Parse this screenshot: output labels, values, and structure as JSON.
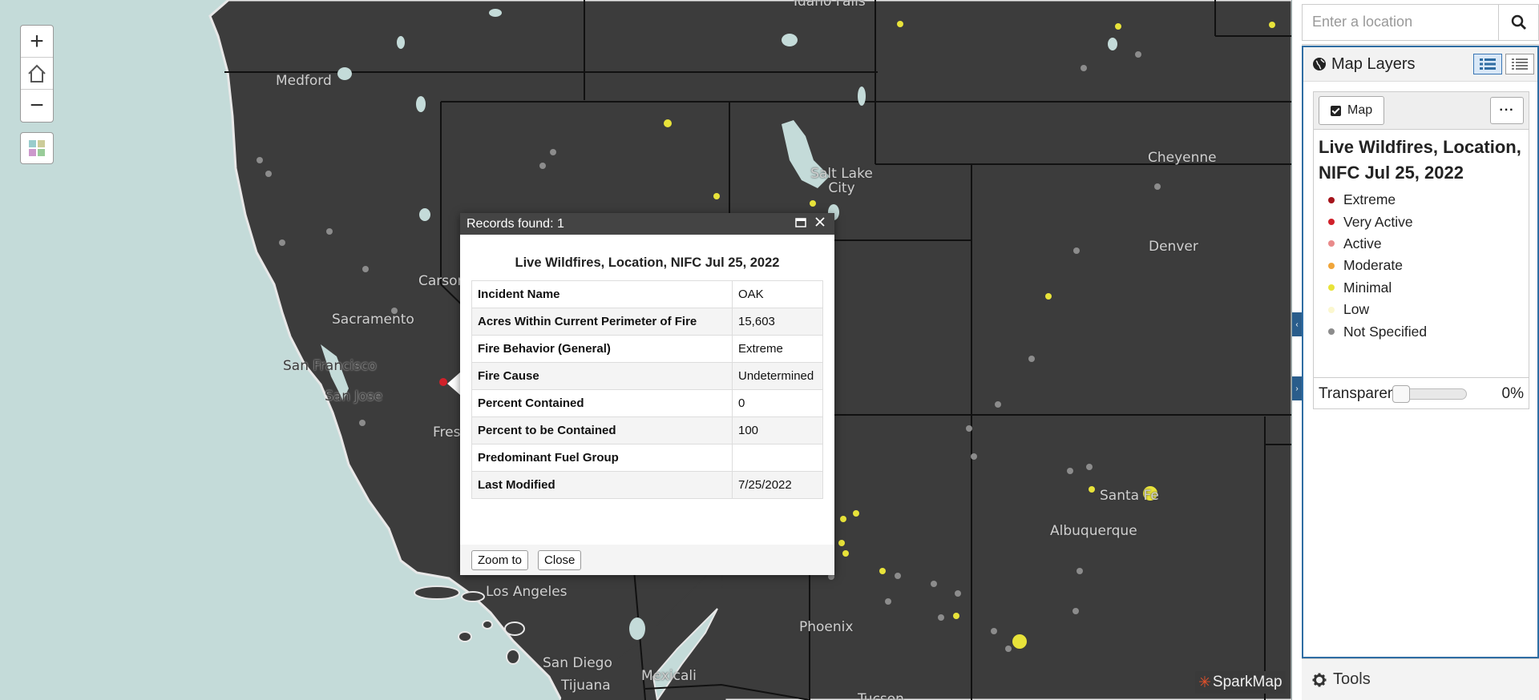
{
  "map": {
    "cities": [
      {
        "name": "Medford"
      },
      {
        "name": "Sacramento"
      },
      {
        "name": "San Francisco"
      },
      {
        "name": "San Jose"
      },
      {
        "name": "Carson"
      },
      {
        "name": "Fresn"
      },
      {
        "name": "Salt Lake City"
      },
      {
        "name": "Cheyenne"
      },
      {
        "name": "Denver"
      },
      {
        "name": "Santa Fe"
      },
      {
        "name": "Albuquerque"
      },
      {
        "name": "Los Angeles"
      },
      {
        "name": "Phoenix"
      },
      {
        "name": "San Diego"
      },
      {
        "name": "Tijuana"
      },
      {
        "name": "Mexicali"
      },
      {
        "name": "Idaho Falls"
      },
      {
        "name": "Tucson"
      }
    ],
    "controls": {
      "zoom_in": "+",
      "zoom_out": "−"
    },
    "logo": "SparkMap"
  },
  "popup": {
    "records_found": "Records found: 1",
    "heading": "Live Wildfires, Location, NIFC Jul 25, 2022",
    "rows": [
      {
        "key": "Incident Name",
        "value": "OAK"
      },
      {
        "key": "Acres Within Current Perimeter of Fire",
        "value": "15,603"
      },
      {
        "key": "Fire Behavior (General)",
        "value": "Extreme"
      },
      {
        "key": "Fire Cause",
        "value": "Undetermined"
      },
      {
        "key": "Percent Contained",
        "value": "0"
      },
      {
        "key": "Percent to be Contained",
        "value": "100"
      },
      {
        "key": "Predominant Fuel Group",
        "value": ""
      },
      {
        "key": "Last Modified",
        "value": "7/25/2022"
      }
    ],
    "zoom_to_label": "Zoom to",
    "close_label": "Close"
  },
  "search": {
    "placeholder": "Enter a location"
  },
  "layers": {
    "title": "Map Layers",
    "map_toggle_label": "Map",
    "more_label": "···",
    "layer_name": "Live Wildfires, Location, NIFC Jul 25, 2022",
    "legend": [
      {
        "label": "Extreme",
        "color": "#a5141b"
      },
      {
        "label": "Very Active",
        "color": "#d0212a"
      },
      {
        "label": "Active",
        "color": "#e98b8b"
      },
      {
        "label": "Moderate",
        "color": "#f0a53a"
      },
      {
        "label": "Minimal",
        "color": "#e8e33a"
      },
      {
        "label": "Low",
        "color": "#fbf7cf"
      },
      {
        "label": "Not Specified",
        "color": "#8c8c8c"
      }
    ],
    "transparency_label": "Transparency",
    "transparency_value": "0%",
    "transparency_level": 0
  },
  "tools": {
    "label": "Tools"
  },
  "colors": {
    "accent": "#2f6da3",
    "land": "#3c3c3c",
    "water": "#c4dbd9"
  }
}
